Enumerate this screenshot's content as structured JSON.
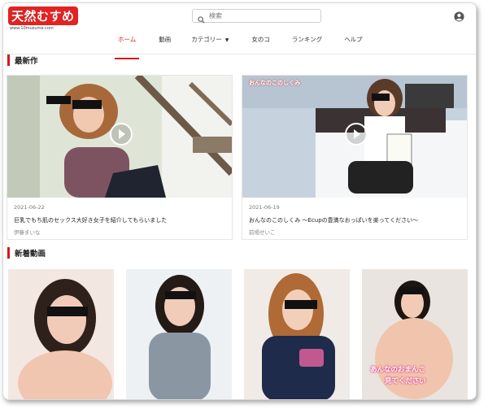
{
  "header": {
    "logo_text": "天然むすめ",
    "logo_url": "www.10musume.com",
    "search_placeholder": "検索"
  },
  "nav": {
    "items": [
      {
        "label": "ホーム",
        "active": true
      },
      {
        "label": "動画"
      },
      {
        "label": "カテゴリー"
      },
      {
        "label": "女のコ"
      },
      {
        "label": "ランキング"
      },
      {
        "label": "ヘルプ"
      }
    ]
  },
  "sections": {
    "latest": "最新作",
    "new_videos": "新着動画"
  },
  "latest": [
    {
      "date": "2021-06-22",
      "title": "巨乳でもち肌のセックス大好き女子を紹介してもらいました",
      "actress": "伊藤まいな"
    },
    {
      "date": "2021-06-19",
      "title": "おんなのこのしくみ ～Ecupの豊満なおっぱいを楽ってください～",
      "actress": "前場せいこ",
      "overlay": "おんなのこのしくみ"
    }
  ],
  "new_videos": {
    "overlay_text": [
      "あんなのおまんこ",
      "見てください"
    ]
  },
  "colors": {
    "accent": "#d11a1a",
    "logo_bg": "#e32222"
  }
}
